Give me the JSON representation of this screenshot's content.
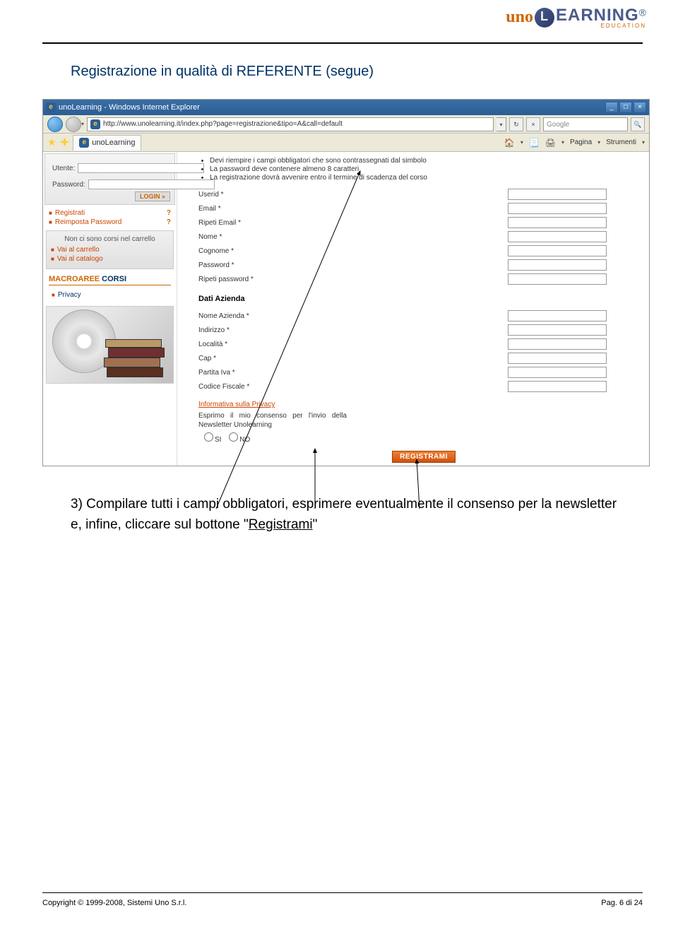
{
  "header": {
    "logo_uno": "uno",
    "logo_earning": "EARNING",
    "logo_education": "EDUCATION",
    "reg": "®"
  },
  "section_title": "Registrazione in qualità di REFERENTE (segue)",
  "ie": {
    "window_title": "unoLearning - Windows Internet Explorer",
    "url": "http://www.unolearning.it/index.php?page=registrazione&tipo=A&call=default",
    "search_placeholder": "Google",
    "tab_label": "unoLearning",
    "tb_home": "🏠",
    "tb_feed": "📃",
    "tb_print": "🖨",
    "tb_page": "Pagina",
    "tb_tools": "Strumenti"
  },
  "sidebar": {
    "utente": "Utente:",
    "password": "Password:",
    "login": "LOGIN  »",
    "registrati": "Registrati",
    "reimposta": "Reimposta Password",
    "cart_empty": "Non ci sono corsi nel carrello",
    "vai_carrello": "Vai al carrello",
    "vai_catalogo": "Vai al catalogo",
    "macro_m": "MACROAREE",
    "macro_c": " CORSI",
    "privacy": "Privacy"
  },
  "form": {
    "bullets": [
      "Devi riempire i campi obbligatori che sono contrassegnati dal simbolo",
      "La password deve contenere almeno 8 caratteri",
      "La registrazione dovrà avvenire entro il termine di scadenza del corso"
    ],
    "fields": [
      "Userid *",
      "Email *",
      "Ripeti Email *",
      "Nome *",
      "Cognome *",
      "Password *",
      "Ripeti password *"
    ],
    "dati_azienda": "Dati Azienda",
    "azienda_fields": [
      "Nome Azienda *",
      "Indirizzo *",
      "Località *",
      "Cap *",
      "Partita Iva *",
      "Codice Fiscale *"
    ],
    "privacy_link": "Informativa sulla Privacy",
    "consent_text": "Esprimo il mio consenso per l'invio della Newsletter Unolearning",
    "si": "SI",
    "no": "NO",
    "registrami": "REGISTRAMI"
  },
  "instruction": {
    "text_before": "3) Compilare tutti i campi obbligatori, esprimere eventualmente il consenso per la newsletter e, infine, cliccare sul bottone \"",
    "link": "Registrami",
    "text_after": "\""
  },
  "footer": {
    "copyright": "Copyright © 1999-2008, Sistemi Uno S.r.l.",
    "page": "Pag. 6 di 24"
  }
}
